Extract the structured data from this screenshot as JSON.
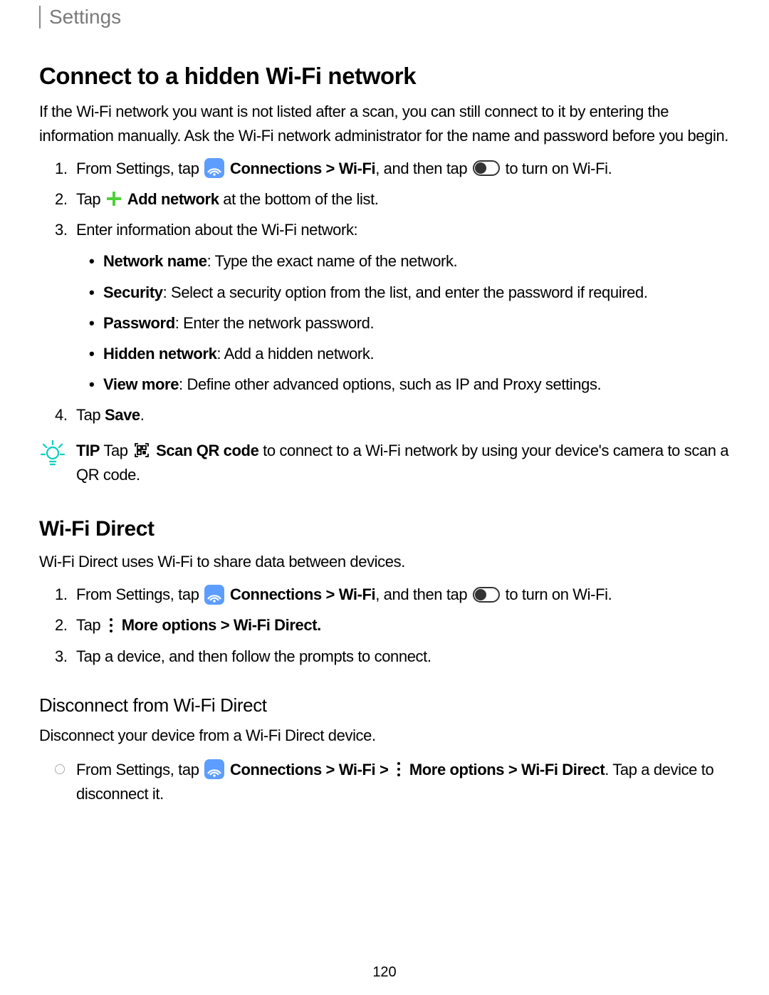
{
  "header": {
    "title": "Settings"
  },
  "section1": {
    "heading": "Connect to a hidden Wi-Fi network",
    "intro": "If the Wi-Fi network you want is not listed after a scan, you can still connect to it by entering the information manually. Ask the Wi-Fi network administrator for the name and password before you begin.",
    "step1": {
      "pre": "From Settings, tap ",
      "connections": "Connections",
      "gt": " > ",
      "wifi": "Wi-Fi",
      "mid": ", and then tap ",
      "post": " to turn on Wi-Fi."
    },
    "step2": {
      "pre": "Tap ",
      "addnet": "Add network",
      "post": " at the bottom of the list."
    },
    "step3": {
      "intro": "Enter information about the Wi-Fi network:",
      "items": {
        "netname_label": "Network name",
        "netname_text": ": Type the exact name of the network.",
        "sec_label": "Security",
        "sec_text": ": Select a security option from the list, and enter the password if required.",
        "pw_label": "Password",
        "pw_text": ": Enter the network password.",
        "hidden_label": "Hidden network",
        "hidden_text": ": Add a hidden network.",
        "more_label": "View more",
        "more_text": ": Define other advanced options, such as IP and Proxy settings."
      }
    },
    "step4": {
      "pre": "Tap ",
      "save": "Save",
      "post": "."
    },
    "tip": {
      "label": "TIP",
      "pre": " Tap ",
      "scan": "Scan QR code",
      "post": " to connect to a Wi-Fi network by using your device's camera to scan a QR code."
    }
  },
  "section2": {
    "heading": "Wi-Fi Direct",
    "intro": "Wi-Fi Direct uses Wi-Fi to share data between devices.",
    "step1": {
      "pre": "From Settings, tap ",
      "connections": "Connections",
      "gt": " > ",
      "wifi": "Wi-Fi",
      "mid": ", and then tap ",
      "post": " to turn on Wi-Fi."
    },
    "step2": {
      "pre": "Tap ",
      "more": "More options",
      "gt": " > ",
      "wifidirect": "Wi-Fi Direct",
      "post": "."
    },
    "step3": "Tap a device, and then follow the prompts to connect."
  },
  "section3": {
    "heading": "Disconnect from Wi-Fi Direct",
    "intro": "Disconnect your device from a Wi-Fi Direct device.",
    "bullet": {
      "pre": "From Settings, tap ",
      "connections": "Connections",
      "gt1": " > ",
      "wifi": "Wi-Fi",
      "gt2": " > ",
      "more": "More options",
      "gt3": " > ",
      "wifidirect": "Wi-Fi Direct",
      "post": ". Tap a device to disconnect it."
    }
  },
  "page_number": "120"
}
